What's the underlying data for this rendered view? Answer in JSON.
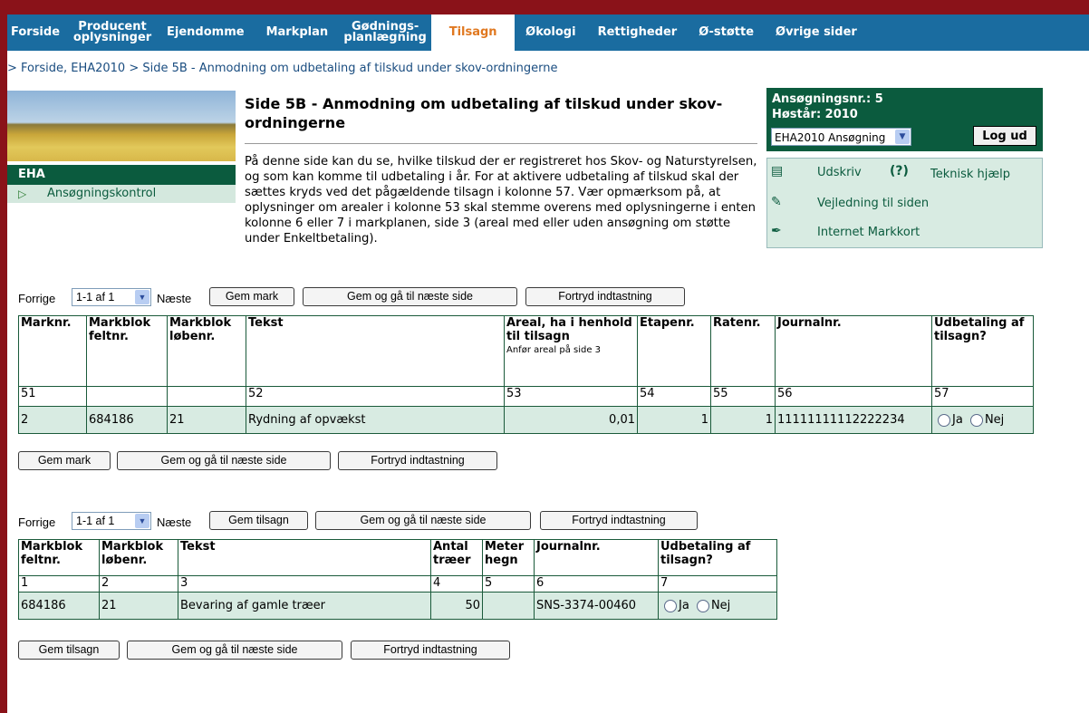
{
  "nav": [
    {
      "label": "Forside"
    },
    {
      "label": "Producent oplysninger"
    },
    {
      "label": "Ejendomme"
    },
    {
      "label": "Markplan"
    },
    {
      "label": "Gødnings-planlægning"
    },
    {
      "label": "Tilsagn"
    },
    {
      "label": "Økologi"
    },
    {
      "label": "Rettigheder"
    },
    {
      "label": "Ø-støtte"
    },
    {
      "label": "Øvrige sider"
    }
  ],
  "breadcrumb": "> Forside, EHA2010 > Side 5B - Anmodning om udbetaling af tilskud under skov-ordningerne",
  "sidebar": {
    "heading": "EHA",
    "link": "Ansøgningskontrol"
  },
  "page": {
    "title": "Side 5B - Anmodning om udbetaling af tilskud under skov-ordningerne",
    "description": "På denne side kan du se, hvilke tilskud der er registreret hos Skov- og Naturstyrelsen, og som kan komme til udbetaling i år. For at aktivere udbetaling af tilskud skal der sættes kryds ved det pågældende tilsagn i kolonne 57. Vær opmærksom på, at oplysninger om arealer i kolonne 53 skal stemme overens med oplysningerne i enten kolonne 6 eller 7 i markplanen, side 3 (areal med eller uden ansøgning om støtte under Enkeltbetaling)."
  },
  "app": {
    "application_no": "Ansøgningsnr.: 5",
    "harvest_year": "Høstår: 2010",
    "selected": "EHA2010 Ansøgning",
    "logout": "Log ud"
  },
  "help": {
    "print": "Udskriv",
    "tech": "Teknisk hjælp",
    "guide": "Vejledning til siden",
    "map": "Internet Markkort"
  },
  "pager1": {
    "prev": "Forrige",
    "range": "1-1 af 1",
    "next": "Næste"
  },
  "pager2": {
    "prev": "Forrige",
    "range": "1-1 af 1",
    "next": "Næste"
  },
  "buttons": {
    "gem_mark": "Gem mark",
    "gem_tilsagn": "Gem tilsagn",
    "gem_next": "Gem og gå til næste side",
    "cancel": "Fortryd indtastning"
  },
  "table1": {
    "headers": [
      "Marknr.",
      "Markblok feltnr.",
      "Markblok løbenr.",
      "Tekst",
      "Areal, ha i henhold til tilsagn",
      "Etapenr.",
      "Ratenr.",
      "Journalnr.",
      "Udbetaling af tilsagn?"
    ],
    "area_note": "Anfør areal på side 3",
    "colnums": [
      "51",
      "",
      "",
      "52",
      "53",
      "54",
      "55",
      "56",
      "57"
    ],
    "row": [
      "2",
      "684186",
      "21",
      "Rydning af opvækst",
      "0,01",
      "1",
      "1",
      "11111111112222234"
    ],
    "yes": "Ja",
    "no": "Nej"
  },
  "table2": {
    "headers": [
      "Markblok feltnr.",
      "Markblok løbenr.",
      "Tekst",
      "Antal træer",
      "Meter hegn",
      "Journalnr.",
      "Udbetaling af tilsagn?"
    ],
    "colnums": [
      "1",
      "2",
      "3",
      "4",
      "5",
      "6",
      "7"
    ],
    "row": [
      "684186",
      "21",
      "Bevaring af gamle træer",
      "50",
      "",
      "SNS-3374-00460"
    ],
    "yes": "Ja",
    "no": "Nej"
  }
}
